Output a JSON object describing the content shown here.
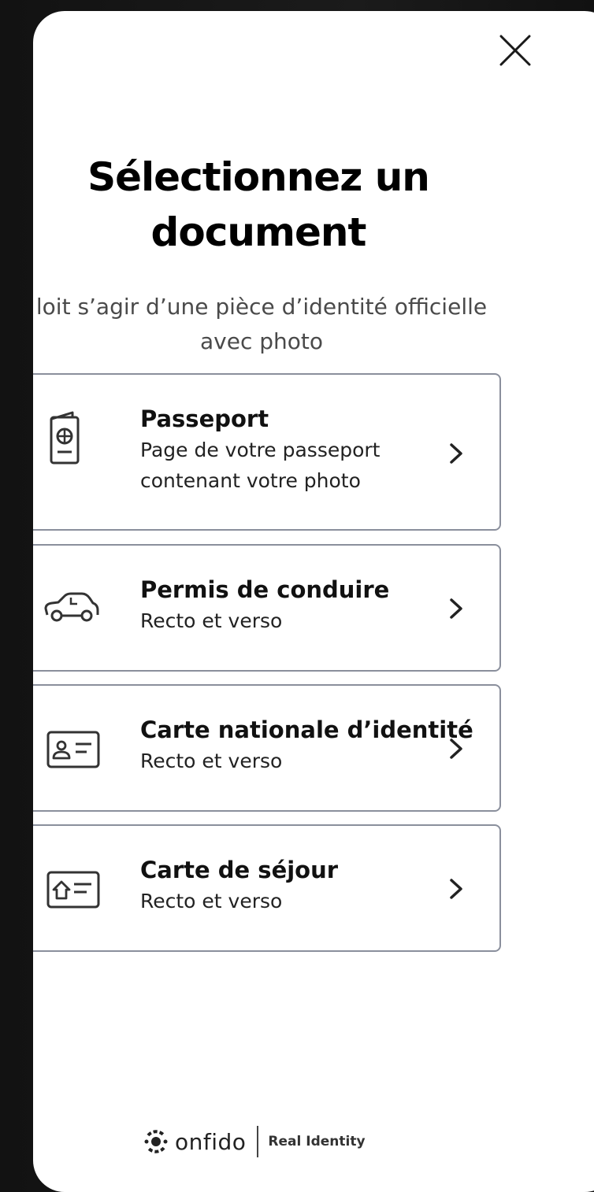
{
  "header": {
    "close_icon": "close-icon"
  },
  "page": {
    "title_line1": "Sélectionnez un",
    "title_line2": "document",
    "subtitle_line1": "loit s’agir d’une pièce d’identité officielle",
    "subtitle_line2": "avec photo"
  },
  "documents": [
    {
      "icon": "passport-icon",
      "name": "Passeport",
      "desc_line1": "Page de votre passeport",
      "desc_line2": "contenant votre photo"
    },
    {
      "icon": "car-icon",
      "name": "Permis de conduire",
      "desc_line1": "Recto et verso"
    },
    {
      "icon": "id-card-icon",
      "name": "Carte nationale d’identité",
      "desc_line1": "Recto et verso"
    },
    {
      "icon": "residence-card-icon",
      "name": "Carte de séjour",
      "desc_line1": "Recto et verso"
    }
  ],
  "footer": {
    "brand": "onfido",
    "tagline": "Real Identity"
  },
  "colors": {
    "background": "#161616",
    "card_border": "#8a8f9c",
    "text_primary": "#111111",
    "text_secondary": "#4a4a4a"
  }
}
